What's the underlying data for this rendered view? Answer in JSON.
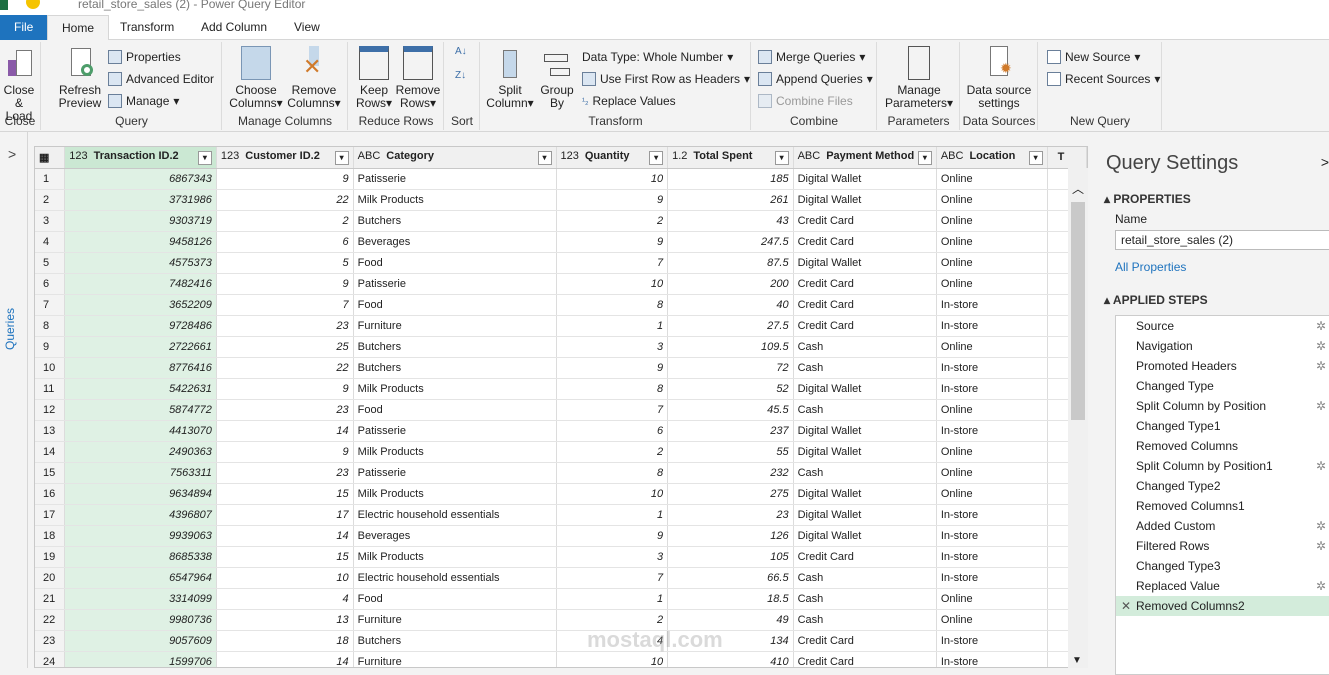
{
  "window": {
    "title": "retail_store_sales (2) - Power Query Editor"
  },
  "tabs": [
    "File",
    "Home",
    "Transform",
    "Add Column",
    "View"
  ],
  "ribbon": {
    "close": {
      "close_load": "Close &",
      "close_load2": "Load",
      "label": "Close"
    },
    "query": {
      "refresh": "Refresh",
      "refresh2": "Preview",
      "properties": "Properties",
      "advanced": "Advanced Editor",
      "manage": "Manage",
      "label": "Query"
    },
    "manage_columns": {
      "choose": "Choose",
      "choose2": "Columns",
      "remove": "Remove",
      "remove2": "Columns",
      "label": "Manage Columns"
    },
    "reduce_rows": {
      "keep": "Keep",
      "keep2": "Rows",
      "remove": "Remove",
      "remove2": "Rows",
      "label": "Reduce Rows"
    },
    "sort": {
      "label": "Sort"
    },
    "transform": {
      "split": "Split",
      "split2": "Column",
      "group": "Group",
      "group2": "By",
      "data_type": "Data Type: Whole Number",
      "first_row": "Use First Row as Headers",
      "replace": "Replace Values",
      "label": "Transform"
    },
    "combine": {
      "merge": "Merge Queries",
      "append": "Append Queries",
      "combine_files": "Combine Files",
      "label": "Combine"
    },
    "parameters": {
      "manage": "Manage",
      "manage2": "Parameters",
      "label": "Parameters"
    },
    "data_sources": {
      "settings": "Data source",
      "settings2": "settings",
      "label": "Data Sources"
    },
    "new_query": {
      "new_source": "New Source",
      "recent": "Recent Sources",
      "label": "New Query"
    }
  },
  "left_pane": {
    "label": "Queries"
  },
  "table": {
    "columns": [
      {
        "type": "123",
        "name": "Transaction ID.2"
      },
      {
        "type": "123",
        "name": "Customer ID.2"
      },
      {
        "type": "ABC",
        "name": "Category"
      },
      {
        "type": "123",
        "name": "Quantity"
      },
      {
        "type": "1.2",
        "name": "Total Spent"
      },
      {
        "type": "ABC",
        "name": "Payment Method"
      },
      {
        "type": "ABC",
        "name": "Location"
      },
      {
        "type": "",
        "name": "T"
      }
    ],
    "rows": [
      [
        "6867343",
        "9",
        "Patisserie",
        "10",
        "185",
        "Digital Wallet",
        "Online"
      ],
      [
        "3731986",
        "22",
        "Milk Products",
        "9",
        "261",
        "Digital Wallet",
        "Online"
      ],
      [
        "9303719",
        "2",
        "Butchers",
        "2",
        "43",
        "Credit Card",
        "Online"
      ],
      [
        "9458126",
        "6",
        "Beverages",
        "9",
        "247.5",
        "Credit Card",
        "Online"
      ],
      [
        "4575373",
        "5",
        "Food",
        "7",
        "87.5",
        "Digital Wallet",
        "Online"
      ],
      [
        "7482416",
        "9",
        "Patisserie",
        "10",
        "200",
        "Credit Card",
        "Online"
      ],
      [
        "3652209",
        "7",
        "Food",
        "8",
        "40",
        "Credit Card",
        "In-store"
      ],
      [
        "9728486",
        "23",
        "Furniture",
        "1",
        "27.5",
        "Credit Card",
        "In-store"
      ],
      [
        "2722661",
        "25",
        "Butchers",
        "3",
        "109.5",
        "Cash",
        "Online"
      ],
      [
        "8776416",
        "22",
        "Butchers",
        "9",
        "72",
        "Cash",
        "In-store"
      ],
      [
        "5422631",
        "9",
        "Milk Products",
        "8",
        "52",
        "Digital Wallet",
        "In-store"
      ],
      [
        "5874772",
        "23",
        "Food",
        "7",
        "45.5",
        "Cash",
        "Online"
      ],
      [
        "4413070",
        "14",
        "Patisserie",
        "6",
        "237",
        "Digital Wallet",
        "In-store"
      ],
      [
        "2490363",
        "9",
        "Milk Products",
        "2",
        "55",
        "Digital Wallet",
        "Online"
      ],
      [
        "7563311",
        "23",
        "Patisserie",
        "8",
        "232",
        "Cash",
        "Online"
      ],
      [
        "9634894",
        "15",
        "Milk Products",
        "10",
        "275",
        "Digital Wallet",
        "Online"
      ],
      [
        "4396807",
        "17",
        "Electric household essentials",
        "1",
        "23",
        "Digital Wallet",
        "In-store"
      ],
      [
        "9939063",
        "14",
        "Beverages",
        "9",
        "126",
        "Digital Wallet",
        "In-store"
      ],
      [
        "8685338",
        "15",
        "Milk Products",
        "3",
        "105",
        "Credit Card",
        "In-store"
      ],
      [
        "6547964",
        "10",
        "Electric household essentials",
        "7",
        "66.5",
        "Cash",
        "In-store"
      ],
      [
        "3314099",
        "4",
        "Food",
        "1",
        "18.5",
        "Cash",
        "Online"
      ],
      [
        "9980736",
        "13",
        "Furniture",
        "2",
        "49",
        "Cash",
        "Online"
      ],
      [
        "9057609",
        "18",
        "Butchers",
        "4",
        "134",
        "Credit Card",
        "In-store"
      ],
      [
        "1599706",
        "14",
        "Furniture",
        "10",
        "410",
        "Credit Card",
        "In-store"
      ]
    ]
  },
  "query_settings": {
    "title": "Query Settings",
    "properties": "PROPERTIES",
    "name_label": "Name",
    "name_value": "retail_store_sales (2)",
    "all_properties": "All Properties",
    "applied_steps": "APPLIED STEPS",
    "steps": [
      {
        "name": "Source",
        "gear": true
      },
      {
        "name": "Navigation",
        "gear": true
      },
      {
        "name": "Promoted Headers",
        "gear": true
      },
      {
        "name": "Changed Type",
        "gear": false
      },
      {
        "name": "Split Column by Position",
        "gear": true
      },
      {
        "name": "Changed Type1",
        "gear": false
      },
      {
        "name": "Removed Columns",
        "gear": false
      },
      {
        "name": "Split Column by Position1",
        "gear": true
      },
      {
        "name": "Changed Type2",
        "gear": false
      },
      {
        "name": "Removed Columns1",
        "gear": false
      },
      {
        "name": "Added Custom",
        "gear": true
      },
      {
        "name": "Filtered Rows",
        "gear": true
      },
      {
        "name": "Changed Type3",
        "gear": false
      },
      {
        "name": "Replaced Value",
        "gear": true
      },
      {
        "name": "Removed Columns2",
        "gear": false,
        "active": true
      }
    ]
  },
  "watermark": "mostaql.com"
}
